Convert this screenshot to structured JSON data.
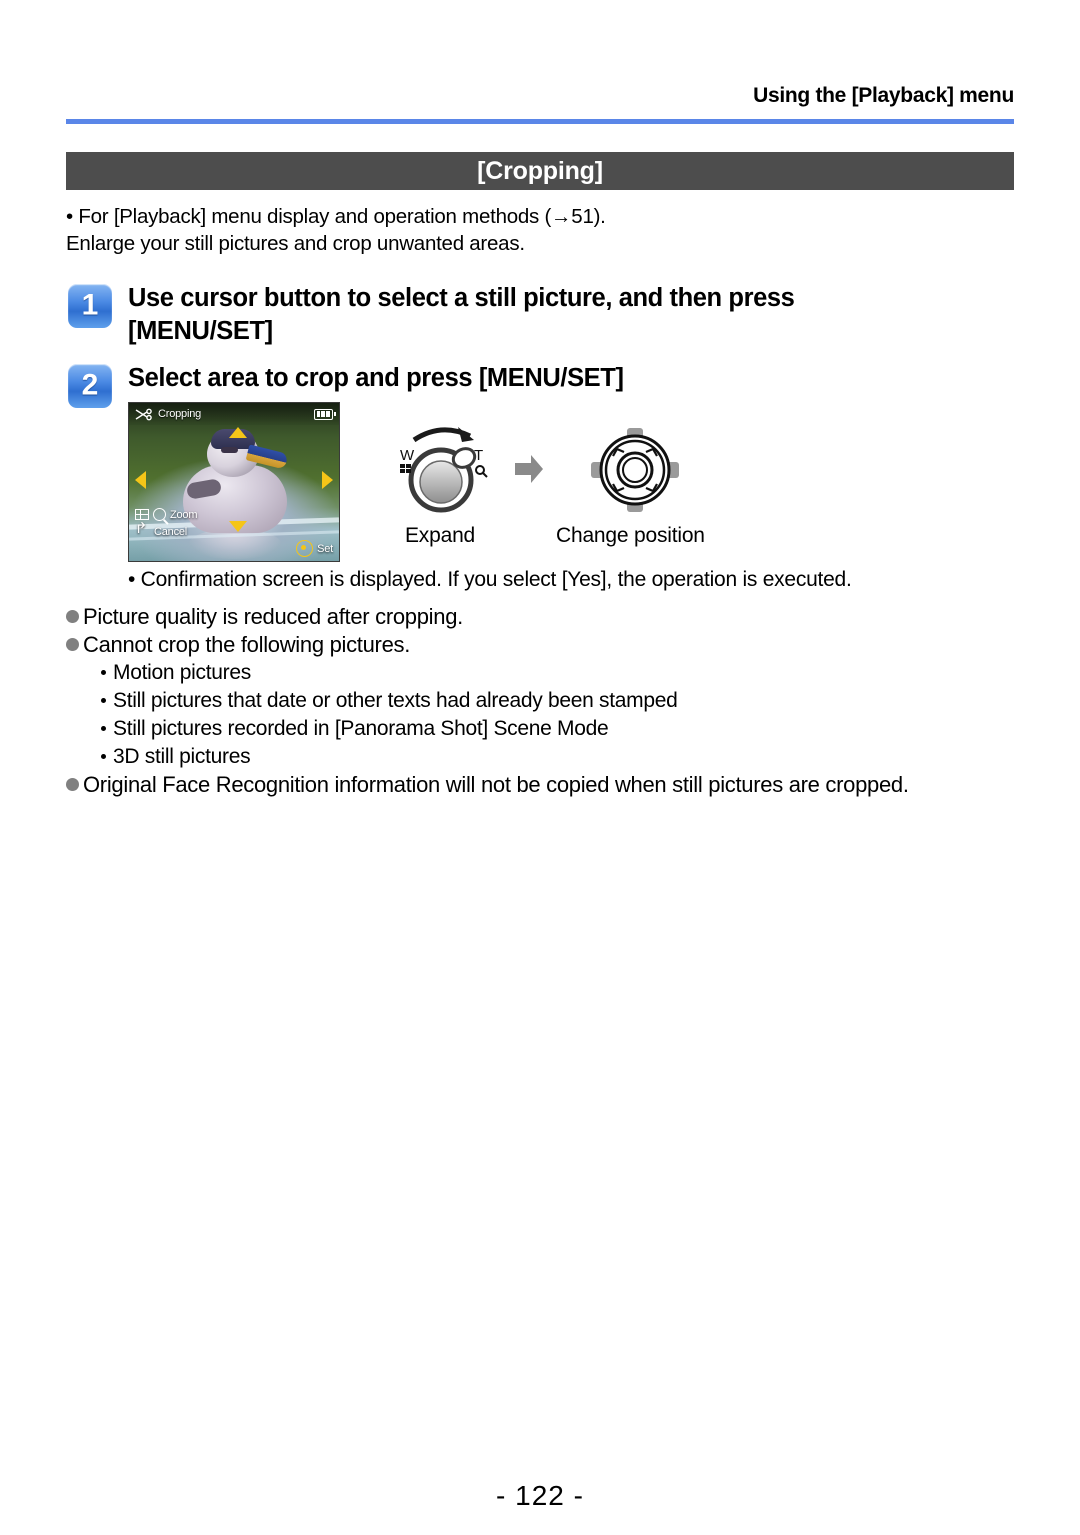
{
  "header": {
    "title": "Using the [Playback] menu",
    "rule_color": "#5a86e8"
  },
  "section": {
    "title": "[Cropping]",
    "title_bar_color": "#4d4d4d"
  },
  "intro": {
    "line1": "• For [Playback] menu display and operation methods (→51).",
    "line2": "Enlarge your still pictures and crop unwanted areas."
  },
  "steps": [
    {
      "number": "1",
      "line1": "Use cursor button to select a still picture, and then press",
      "line2": "[MENU/SET]"
    },
    {
      "number": "2",
      "line1": "Select area to crop and press [MENU/SET]",
      "line2": ""
    }
  ],
  "lcd": {
    "mode_label": "Cropping",
    "scissors_icon": "scissors-icon",
    "battery_icon": "battery-icon",
    "zoom_label": "Zoom",
    "cancel_label": "Cancel",
    "set_label": "Set",
    "cursor_up_icon": "triangle-up-icon",
    "cursor_down_icon": "triangle-down-icon",
    "cursor_left_icon": "triangle-left-icon",
    "cursor_right_icon": "triangle-right-icon"
  },
  "diagrams": {
    "lever": {
      "wide_label": "W",
      "tele_label": "T",
      "caption": "Expand"
    },
    "transition_icon": "arrow-right-icon",
    "cursor": {
      "caption": "Change position"
    }
  },
  "confirm_note": "• Confirmation screen is displayed. If you select [Yes], the operation is executed.",
  "notes": [
    {
      "text": "Picture quality is reduced after cropping.",
      "sub": []
    },
    {
      "text": "Cannot crop the following pictures.",
      "sub": [
        "Motion pictures",
        "Still pictures that date or other texts had already been stamped",
        "Still pictures recorded in [Panorama Shot] Scene Mode",
        "3D still pictures"
      ]
    },
    {
      "text": "Original Face Recognition information will not be copied when still pictures are cropped.",
      "sub": []
    }
  ],
  "footer": {
    "page_number": "- 122 -"
  }
}
